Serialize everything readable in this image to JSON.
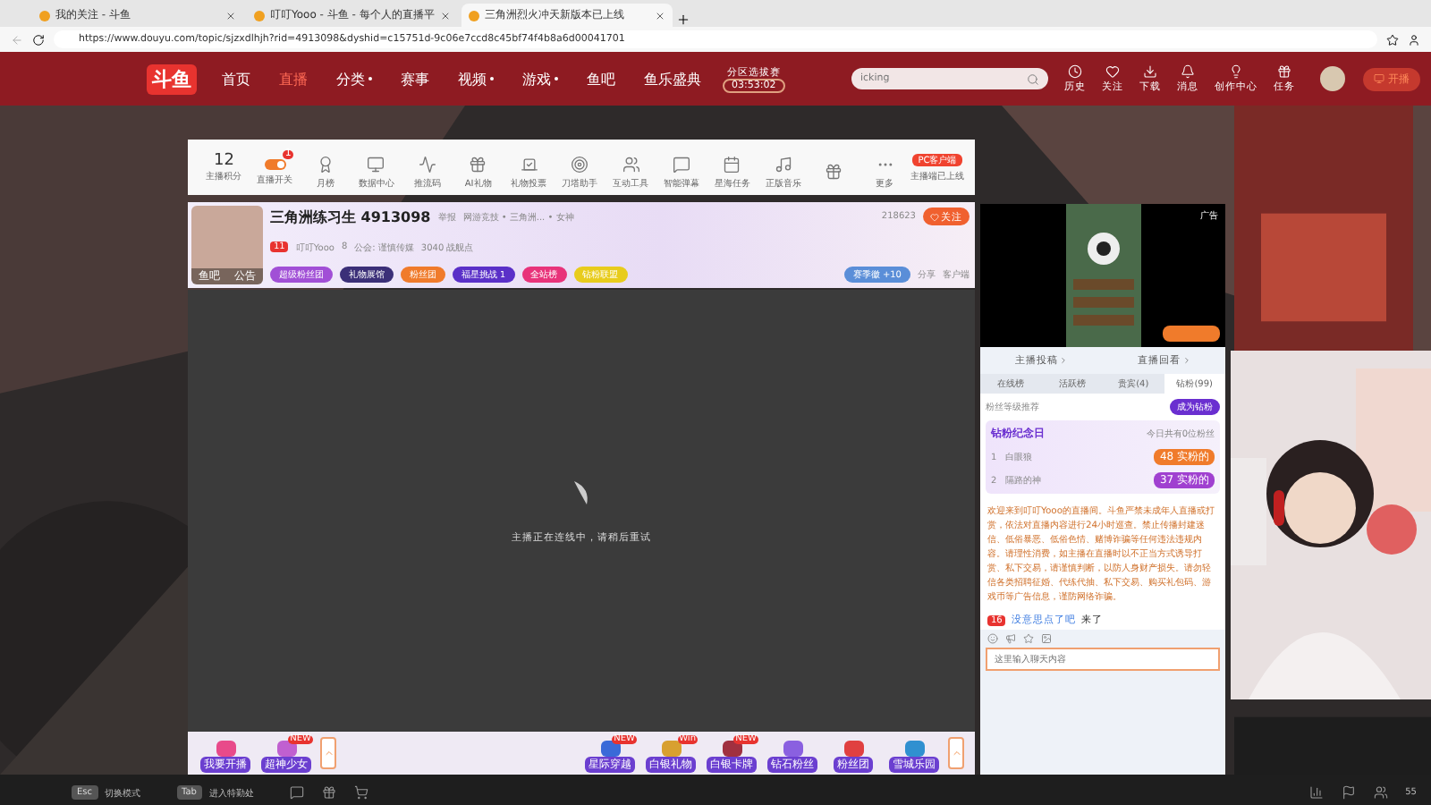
{
  "browser": {
    "tabs": [
      {
        "title": "我的关注 - 斗鱼",
        "selected": false
      },
      {
        "title": "叮叮Yooo - 斗鱼 - 每个人的直播平",
        "selected": false
      },
      {
        "title": "三角洲烈火冲天新版本已上线",
        "selected": true
      }
    ],
    "url": "https://www.douyu.com/topic/sjzxdlhjh?rid=4913098&dyshid=c15751d-9c06e7ccd8c45bf74f4b8a6d00041701"
  },
  "header": {
    "logo": "斗鱼",
    "nav": [
      {
        "label": "首页",
        "selected": false,
        "dropdown": false
      },
      {
        "label": "直播",
        "selected": true,
        "dropdown": false
      },
      {
        "label": "分类",
        "selected": false,
        "dropdown": true
      },
      {
        "label": "赛事",
        "selected": false,
        "dropdown": false
      },
      {
        "label": "视频",
        "selected": false,
        "dropdown": true
      },
      {
        "label": "游戏",
        "selected": false,
        "dropdown": true
      },
      {
        "label": "鱼吧",
        "selected": false,
        "dropdown": false
      },
      {
        "label": "鱼乐盛典",
        "selected": false,
        "dropdown": false
      }
    ],
    "event": {
      "title": "分区选拔赛",
      "time": "03:53:02"
    },
    "search": {
      "value": "icking"
    },
    "actions": [
      {
        "label": "历史"
      },
      {
        "label": "关注"
      },
      {
        "label": "下载"
      },
      {
        "label": "消息"
      },
      {
        "label": "创作中心"
      },
      {
        "label": "任务"
      }
    ],
    "broadcast": "开播"
  },
  "toolbar": {
    "score": "12",
    "score_label": "主播积分",
    "tools": [
      {
        "label": "直播开关",
        "kind": "toggle",
        "on": true,
        "badge": "1"
      },
      {
        "label": "月榜",
        "kind": "button"
      },
      {
        "label": "数据中心",
        "kind": "button"
      },
      {
        "label": "推流码",
        "kind": "button"
      },
      {
        "label": "AI礼物",
        "kind": "button"
      },
      {
        "label": "礼物投票",
        "kind": "button"
      },
      {
        "label": "刀塔助手",
        "kind": "button"
      },
      {
        "label": "互动工具",
        "kind": "button"
      },
      {
        "label": "智能弹幕",
        "kind": "button"
      },
      {
        "label": "星海任务",
        "kind": "button"
      },
      {
        "label": "正版音乐",
        "kind": "button"
      },
      {
        "kind": "button"
      },
      {
        "label": "更多",
        "kind": "button"
      }
    ],
    "client_pill": "PC客户端",
    "client_note": "主播端已上线"
  },
  "room": {
    "avatar_tabs": [
      "鱼吧",
      "公告"
    ],
    "title": "三角洲练习生 4913098",
    "report": "举报",
    "category": "网游竞技 • 三角洲... • 女神",
    "level": "11",
    "anchor": "叮叮Yooo",
    "heat": "8",
    "guild": "公会: 谨慎传媒",
    "points": "3040 战舰点",
    "pills": [
      {
        "label": "超级粉丝团",
        "color": "#a14fd6"
      },
      {
        "label": "礼物展馆",
        "color": "#3b2f78"
      },
      {
        "label": "粉丝团",
        "color": "#f07b2b"
      },
      {
        "label": "福星挑战 1",
        "color": "#5a30c8"
      },
      {
        "label": "全站榜",
        "color": "#e8337a"
      },
      {
        "label": "钻粉联盟",
        "color": "#e8cc1c"
      }
    ],
    "viewers": "218623",
    "follow": "关注",
    "season": "赛季徽",
    "season_plus": "+10",
    "share": "分享",
    "client": "客户端"
  },
  "video": {
    "status": "主播正在连线中，请稍后重试"
  },
  "gifts": {
    "left": [
      {
        "label": "我要开播"
      },
      {
        "label": "超神少女",
        "badge": "NEW"
      }
    ],
    "right": [
      {
        "label": "星际穿越",
        "badge": "NEW"
      },
      {
        "label": "白银礼物",
        "badge": "Win"
      },
      {
        "label": "白银卡牌",
        "badge": "NEW"
      },
      {
        "label": "钻石粉丝"
      },
      {
        "label": "粉丝团"
      },
      {
        "label": "雪城乐园"
      }
    ]
  },
  "side": {
    "ad_label": "广告",
    "links": [
      "主播投稿",
      "直播回看"
    ],
    "rank_tabs": [
      {
        "label": "在线榜",
        "selected": false
      },
      {
        "label": "活跃榜",
        "selected": false
      },
      {
        "label": "贵宾(4)",
        "selected": false
      },
      {
        "label": "钻粉(99)",
        "selected": true
      }
    ],
    "fan_hint": "粉丝等级推荐",
    "become": "成为钻粉",
    "anniversary": "钻粉纪念日",
    "anniversary_note": "今日共有0位粉丝",
    "fans": [
      {
        "rank": "1",
        "name": "白眼狼",
        "level": "48",
        "badge": "实粉的"
      },
      {
        "rank": "2",
        "name": "隔路的神",
        "level": "37",
        "badge": "实粉的"
      }
    ],
    "notice": "欢迎来到叮叮Yooo的直播间。斗鱼严禁未成年人直播或打赏，依法对直播内容进行24小时巡查。禁止传播封建迷信、低俗暴恶、低俗色情、赌博诈骗等任何违法违规内容。请理性消费，如主播在直播时以不正当方式诱导打赏、私下交易，请谨慎判断，以防人身财产损失。请勿轻信各类招聘征婚、代练代抽、私下交易、购买礼包码、游戏币等广告信息，谨防网络诈骗。",
    "chat": {
      "level": "16",
      "user": "没意思点了吧",
      "text": "来了"
    },
    "input_placeholder": "这里输入聊天内容"
  },
  "overlay": {
    "keys": [
      {
        "key": "Esc",
        "label": "切换模式"
      },
      {
        "key": "Tab",
        "label": "进入特勤处"
      }
    ],
    "count": "55"
  }
}
